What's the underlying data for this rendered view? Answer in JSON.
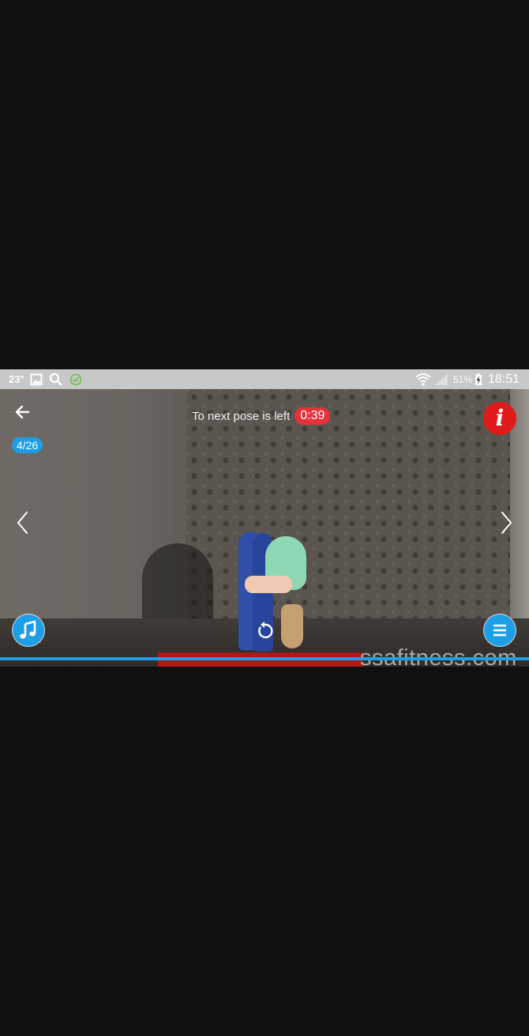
{
  "status_bar": {
    "temperature": "23°",
    "battery_percent": "51%",
    "time": "18:51",
    "icons": [
      "gallery-icon",
      "search-icon",
      "check-circle-icon",
      "wifi-icon",
      "signal-icon",
      "battery-charging-icon"
    ]
  },
  "player": {
    "progress_label": "4/26",
    "timer_label": "To next pose is left",
    "timer_value": "0:39",
    "watermark": "ssafitness.com",
    "info_glyph": "i",
    "accent_color": "#1e9ee6",
    "timer_color": "#e8323a",
    "info_color": "#e01b1b",
    "icons": [
      "back-arrow-icon",
      "info-icon",
      "chevron-left-icon",
      "chevron-right-icon",
      "music-note-icon",
      "replay-icon",
      "menu-icon"
    ]
  }
}
